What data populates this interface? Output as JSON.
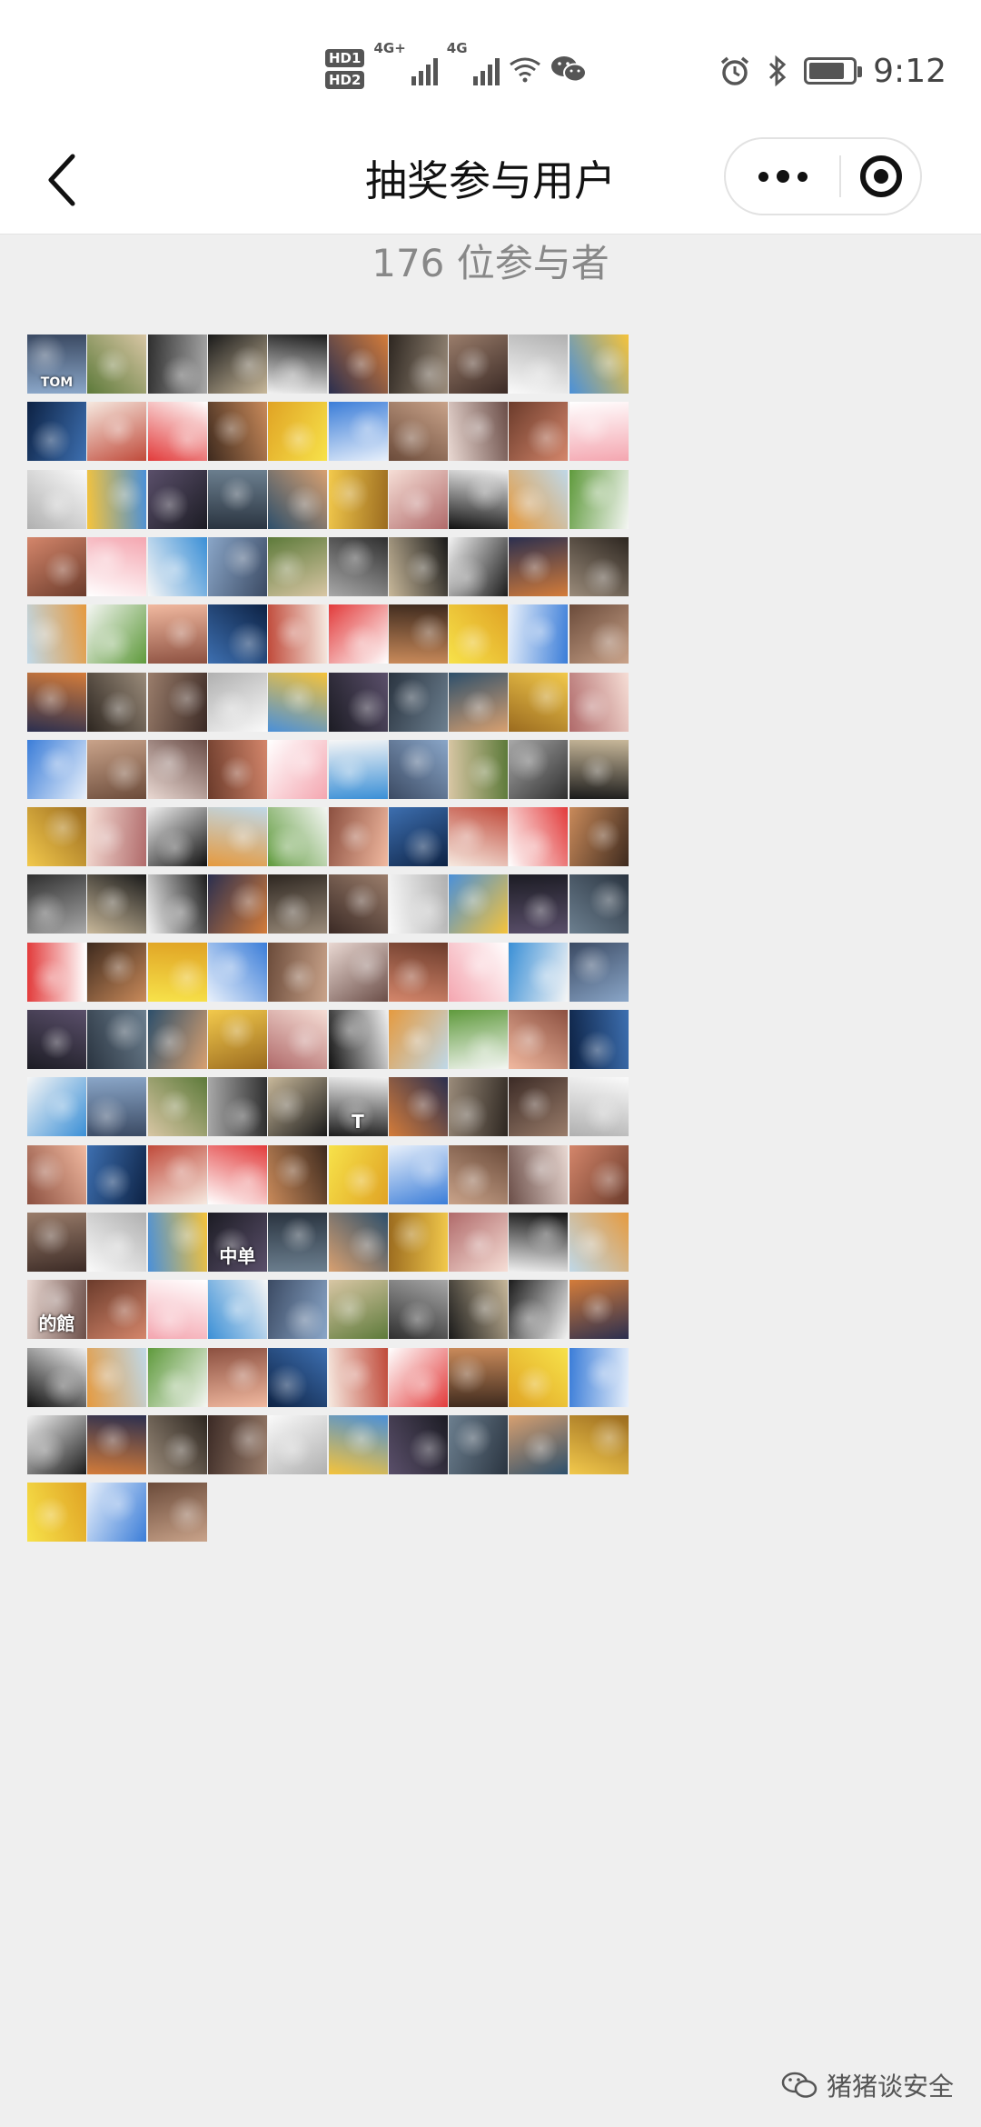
{
  "status_bar": {
    "sim1": "HD1",
    "sim2": "HD2",
    "net1": "4G+",
    "net2": "4G",
    "time": "9:12",
    "icons": [
      "hd-icon",
      "signal-icon",
      "wifi-icon",
      "wechat-icon",
      "alarm-icon",
      "bluetooth-icon",
      "battery-icon"
    ],
    "battery_level": 0.82
  },
  "nav": {
    "title": "抽奖参与用户",
    "back_icon": "chevron-left-icon",
    "more_icon": "more-dots-icon",
    "close_icon": "target-close-icon"
  },
  "participants": {
    "count_label": "176 位参与者",
    "visible_count": 173,
    "columns": 10,
    "palette": [
      [
        "#8aa6c8",
        "#3b4a63"
      ],
      [
        "#f2c94c",
        "#9b6b1f"
      ],
      [
        "#e9d8d2",
        "#6b4e48"
      ],
      [
        "#4a90d9",
        "#f5c33b"
      ],
      [
        "#c98a5a",
        "#3e2a1e"
      ],
      [
        "#d47c3a",
        "#2b2f4f"
      ],
      [
        "#f1b9a0",
        "#8c5040"
      ],
      [
        "#5d7a3a",
        "#d8c6a4"
      ],
      [
        "#f6ded6",
        "#b06a6a"
      ],
      [
        "#6b3b2b",
        "#d4866b"
      ],
      [
        "#1c1c24",
        "#5a4f6a"
      ],
      [
        "#f7e24a",
        "#e0a324"
      ],
      [
        "#9a8b7a",
        "#2d2620"
      ],
      [
        "#0d2244",
        "#3d6fb0"
      ],
      [
        "#2f2f2f",
        "#a8a8a8"
      ],
      [
        "#f0f0f0",
        "#111111"
      ],
      [
        "#ffffff",
        "#f4a6b0"
      ],
      [
        "#2a3440",
        "#6c7f8f"
      ],
      [
        "#e8f0fb",
        "#3b7dd8"
      ],
      [
        "#3b2a25",
        "#9a7d6b"
      ],
      [
        "#f6e9e0",
        "#c04a3a"
      ],
      [
        "#1a1a1a",
        "#c8b89a"
      ],
      [
        "#bfd8e8",
        "#e59a3f"
      ],
      [
        "#f6f6f6",
        "#3a8fd6"
      ],
      [
        "#2d4f6b",
        "#d8a070"
      ],
      [
        "#6b4b3a",
        "#c9a38a"
      ],
      [
        "#fafafa",
        "#b0b0b0"
      ],
      [
        "#ffffff",
        "#e23b3b"
      ],
      [
        "#1c1c1c",
        "#f2f2f2"
      ],
      [
        "#f4f6f3",
        "#5f9a3c"
      ]
    ],
    "special_tiles": [
      {
        "index": 0,
        "text": "TOM"
      },
      {
        "index": 115,
        "text": "T"
      },
      {
        "index": 133,
        "text": "中单"
      },
      {
        "index": 140,
        "text": "的館"
      }
    ]
  },
  "watermark": {
    "icon": "wechat-official-icon",
    "text": "猪猪谈安全"
  }
}
